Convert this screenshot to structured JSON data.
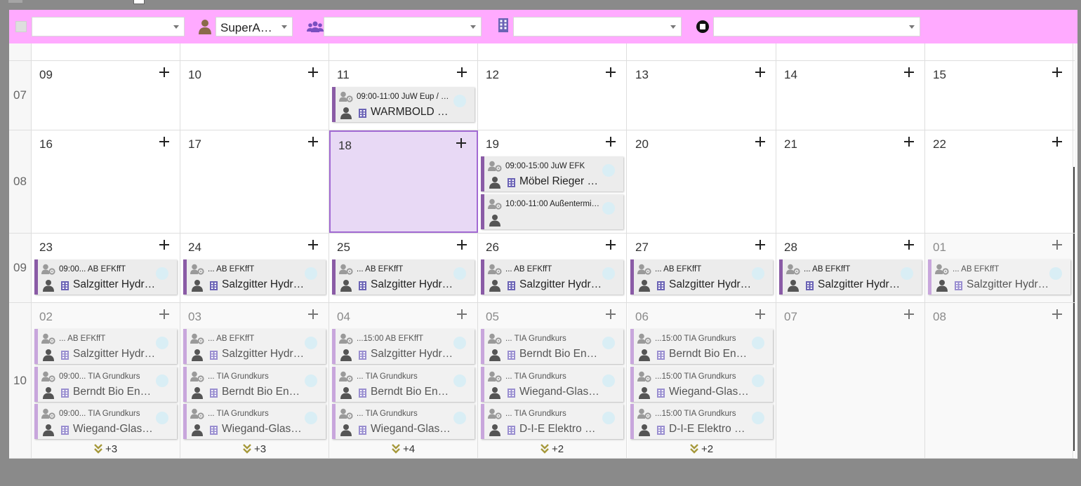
{
  "filters": {
    "user_value": "SuperA…",
    "group_value": "",
    "company_value": "",
    "status_value": "",
    "type_value": ""
  },
  "weeks": [
    {
      "week": "",
      "days": [
        {
          "num": ""
        },
        {
          "num": ""
        },
        {
          "num": ""
        },
        {
          "num": ""
        },
        {
          "num": ""
        },
        {
          "num": ""
        },
        {
          "num": ""
        }
      ]
    },
    {
      "week": "07",
      "days": [
        {
          "num": "09",
          "events": []
        },
        {
          "num": "10",
          "events": []
        },
        {
          "num": "11",
          "events": [
            {
              "time": "09:00-11:00 JuW Eup / …",
              "place": "WARMBOLD …"
            }
          ]
        },
        {
          "num": "12",
          "events": []
        },
        {
          "num": "13",
          "events": []
        },
        {
          "num": "14",
          "events": []
        },
        {
          "num": "15",
          "events": []
        }
      ]
    },
    {
      "week": "08",
      "days": [
        {
          "num": "16",
          "events": []
        },
        {
          "num": "17",
          "events": []
        },
        {
          "num": "18",
          "today": true,
          "events": []
        },
        {
          "num": "19",
          "events": [
            {
              "time": "09:00-15:00 JuW EFK",
              "place": "Möbel Rieger …"
            },
            {
              "time": "10:00-11:00 Außentermi…",
              "place": ""
            }
          ]
        },
        {
          "num": "20",
          "events": []
        },
        {
          "num": "21",
          "events": []
        },
        {
          "num": "22",
          "events": []
        }
      ]
    },
    {
      "week": "09",
      "days": [
        {
          "num": "23",
          "events": [
            {
              "time": "09:00... AB EFKffT",
              "place": "Salzgitter Hydr…"
            }
          ]
        },
        {
          "num": "24",
          "events": [
            {
              "time": "... AB EFKffT",
              "place": "Salzgitter Hydr…"
            }
          ]
        },
        {
          "num": "25",
          "events": [
            {
              "time": "... AB EFKffT",
              "place": "Salzgitter Hydr…"
            }
          ]
        },
        {
          "num": "26",
          "events": [
            {
              "time": "... AB EFKffT",
              "place": "Salzgitter Hydr…"
            }
          ]
        },
        {
          "num": "27",
          "events": [
            {
              "time": "... AB EFKffT",
              "place": "Salzgitter Hydr…"
            }
          ]
        },
        {
          "num": "28",
          "events": [
            {
              "time": "... AB EFKffT",
              "place": "Salzgitter Hydr…"
            }
          ]
        },
        {
          "num": "01",
          "dim": true,
          "events": [
            {
              "time": "... AB EFKffT",
              "place": "Salzgitter Hydr…",
              "faded": true
            }
          ]
        }
      ]
    },
    {
      "week": "10",
      "days": [
        {
          "num": "02",
          "dim": true,
          "more": "+3",
          "events": [
            {
              "time": "... AB EFKffT",
              "place": "Salzgitter Hydr…",
              "faded": true
            },
            {
              "time": "09:00... TIA Grundkurs",
              "place": "Berndt Bio En…",
              "faded": true
            },
            {
              "time": "09:00... TIA Grundkurs",
              "place": "Wiegand-Glas…",
              "faded": true
            }
          ]
        },
        {
          "num": "03",
          "dim": true,
          "more": "+3",
          "events": [
            {
              "time": "... AB EFKffT",
              "place": "Salzgitter Hydr…",
              "faded": true
            },
            {
              "time": "... TIA Grundkurs",
              "place": "Berndt Bio En…",
              "faded": true
            },
            {
              "time": "... TIA Grundkurs",
              "place": "Wiegand-Glas…",
              "faded": true
            }
          ]
        },
        {
          "num": "04",
          "dim": true,
          "more": "+4",
          "events": [
            {
              "time": "...15:00 AB EFKffT",
              "place": "Salzgitter Hydr…",
              "faded": true
            },
            {
              "time": "... TIA Grundkurs",
              "place": "Berndt Bio En…",
              "faded": true
            },
            {
              "time": "... TIA Grundkurs",
              "place": "Wiegand-Glas…",
              "faded": true
            }
          ]
        },
        {
          "num": "05",
          "dim": true,
          "more": "+2",
          "events": [
            {
              "time": "... TIA Grundkurs",
              "place": "Berndt Bio En…",
              "faded": true
            },
            {
              "time": "... TIA Grundkurs",
              "place": "Wiegand-Glas…",
              "faded": true
            },
            {
              "time": "... TIA Grundkurs",
              "place": "D-I-E Elektro …",
              "faded": true
            }
          ]
        },
        {
          "num": "06",
          "dim": true,
          "more": "+2",
          "events": [
            {
              "time": "...15:00 TIA Grundkurs",
              "place": "Berndt Bio En…",
              "faded": true
            },
            {
              "time": "...15:00 TIA Grundkurs",
              "place": "Wiegand-Glas…",
              "faded": true
            },
            {
              "time": "...15:00 TIA Grundkurs",
              "place": "D-I-E Elektro …",
              "faded": true
            }
          ]
        },
        {
          "num": "07",
          "dim": true,
          "events": []
        },
        {
          "num": "08",
          "dim": true,
          "events": []
        }
      ]
    }
  ],
  "colors": {
    "filter_bar": "#ffaaff",
    "event_accent": "#8a5ba6",
    "event_accent_faded": "#c8a6dc",
    "today_bg": "#e8d9f5",
    "today_border": "#a26ad3",
    "more_chevron": "#a6993c"
  },
  "icons": [
    "checkbox-icon",
    "user-icon",
    "group-icon",
    "building-icon",
    "status-icon",
    "caret-down-icon",
    "user-gear-icon",
    "person-icon",
    "plus-icon",
    "double-chevron-down-icon"
  ]
}
